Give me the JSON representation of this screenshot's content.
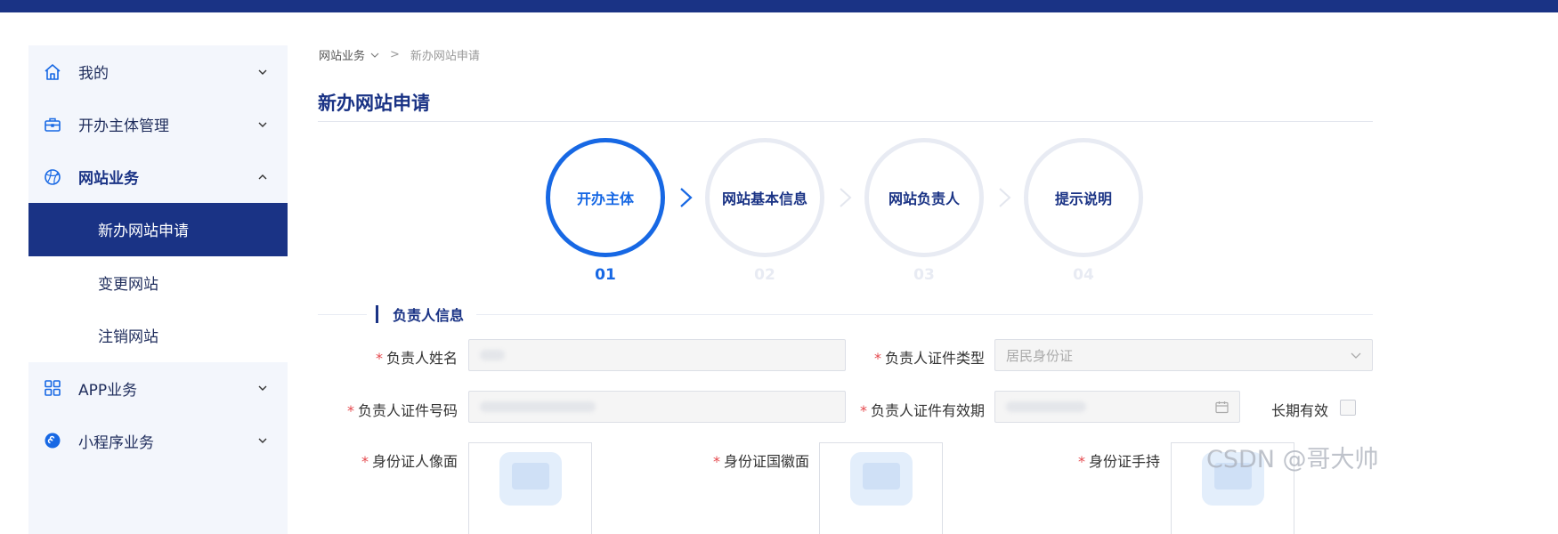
{
  "sidebar": {
    "items": [
      {
        "label": "我的",
        "icon": "home-icon",
        "expanded": false
      },
      {
        "label": "开办主体管理",
        "icon": "briefcase-icon",
        "expanded": false
      },
      {
        "label": "网站业务",
        "icon": "globe-icon",
        "expanded": true
      },
      {
        "label": "APP业务",
        "icon": "apps-grid-icon",
        "expanded": false
      },
      {
        "label": "小程序业务",
        "icon": "mini-program-icon",
        "expanded": false
      }
    ],
    "submenu": [
      {
        "label": "新办网站申请",
        "selected": true
      },
      {
        "label": "变更网站",
        "selected": false
      },
      {
        "label": "注销网站",
        "selected": false
      }
    ]
  },
  "breadcrumb": {
    "parent": "网站业务",
    "current": "新办网站申请"
  },
  "page_title": "新办网站申请",
  "steps": [
    {
      "label": "开办主体",
      "num": "01",
      "active": true
    },
    {
      "label": "网站基本信息",
      "num": "02",
      "active": false
    },
    {
      "label": "网站负责人",
      "num": "03",
      "active": false
    },
    {
      "label": "提示说明",
      "num": "04",
      "active": false
    }
  ],
  "section_title": "负责人信息",
  "form": {
    "name_label": "负责人姓名",
    "id_type_label": "负责人证件类型",
    "id_type_value": "居民身份证",
    "id_number_label": "负责人证件号码",
    "id_validity_label": "负责人证件有效期",
    "long_term_label": "长期有效",
    "id_front_label": "身份证人像面",
    "id_back_label": "身份证国徽面",
    "id_hand_label": "身份证手持"
  },
  "watermark": "CSDN @哥大帅",
  "colors": {
    "primary": "#1a3385",
    "active": "#1768e4",
    "required": "#e5484d"
  }
}
